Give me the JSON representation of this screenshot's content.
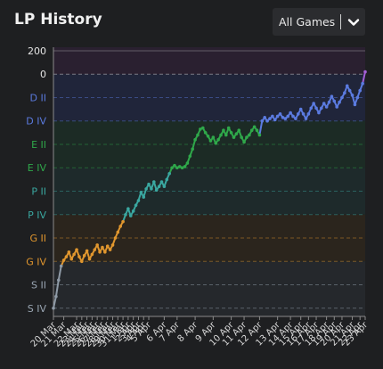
{
  "header": {
    "title": "LP History",
    "filter_label": "All Games"
  },
  "chart_data": {
    "type": "line",
    "title": "LP History",
    "y_ticks": [
      {
        "label": "200",
        "value": 200,
        "color": "#e6e6e6"
      },
      {
        "label": "0",
        "value": 0,
        "color": "#e6e6e6"
      },
      {
        "label": "D II",
        "value": -200,
        "color": "#5b7be0"
      },
      {
        "label": "D IV",
        "value": -400,
        "color": "#5b7be0"
      },
      {
        "label": "E II",
        "value": -600,
        "color": "#2fa84a"
      },
      {
        "label": "E IV",
        "value": -800,
        "color": "#2fa84a"
      },
      {
        "label": "P II",
        "value": -1000,
        "color": "#3aa7a0"
      },
      {
        "label": "P IV",
        "value": -1200,
        "color": "#3aa7a0"
      },
      {
        "label": "G II",
        "value": -1400,
        "color": "#e0962e"
      },
      {
        "label": "G IV",
        "value": -1600,
        "color": "#e0962e"
      },
      {
        "label": "S II",
        "value": -1800,
        "color": "#9aa6b3"
      },
      {
        "label": "S IV",
        "value": -2000,
        "color": "#9aa6b3"
      }
    ],
    "ylim": [
      -2070,
      230
    ],
    "x_ticks": [
      "20 Mar",
      "21 Mar",
      "22 Mar",
      "23 Mar",
      "24 Mar",
      "25 Mar",
      "26 Mar",
      "27 Mar",
      "28 Mar",
      "29 Mar",
      "30 Mar",
      "31 Mar",
      "1 Apr",
      "2 Apr",
      "3 Apr",
      "4 Apr",
      "5 Apr",
      "6 Apr",
      "7 Apr",
      "8 Apr",
      "9 Apr",
      "10 Apr",
      "11 Apr",
      "12 Apr",
      "13 Apr",
      "14 Apr",
      "15 Apr",
      "16 Apr",
      "17 Apr",
      "18 Apr",
      "19 Apr",
      "20 Apr",
      "21 Apr",
      "22 Apr",
      "23 Apr"
    ],
    "tier_colors": {
      "silver": "#8f9aa6",
      "gold": "#e0962e",
      "platinum": "#3aa7a0",
      "emerald": "#2fa84a",
      "diamond": "#5b7be0",
      "master": "#a45fd6"
    },
    "series": [
      {
        "points": [
          [
            0,
            -2000,
            "silver"
          ],
          [
            2,
            -1900,
            "silver"
          ],
          [
            4,
            -1760,
            "silver"
          ],
          [
            6,
            -1640,
            "silver"
          ],
          [
            8,
            -1590,
            "gold"
          ],
          [
            10,
            -1560,
            "gold"
          ],
          [
            12,
            -1520,
            "gold"
          ],
          [
            14,
            -1580,
            "gold"
          ],
          [
            16,
            -1540,
            "gold"
          ],
          [
            18,
            -1500,
            "gold"
          ],
          [
            20,
            -1560,
            "gold"
          ],
          [
            22,
            -1600,
            "gold"
          ],
          [
            24,
            -1550,
            "gold"
          ],
          [
            26,
            -1510,
            "gold"
          ],
          [
            28,
            -1580,
            "gold"
          ],
          [
            30,
            -1540,
            "gold"
          ],
          [
            32,
            -1500,
            "gold"
          ],
          [
            34,
            -1460,
            "gold"
          ],
          [
            36,
            -1520,
            "gold"
          ],
          [
            38,
            -1480,
            "gold"
          ],
          [
            40,
            -1520,
            "gold"
          ],
          [
            42,
            -1470,
            "gold"
          ],
          [
            44,
            -1500,
            "gold"
          ],
          [
            46,
            -1460,
            "gold"
          ],
          [
            48,
            -1400,
            "gold"
          ],
          [
            50,
            -1350,
            "gold"
          ],
          [
            52,
            -1300,
            "gold"
          ],
          [
            54,
            -1260,
            "gold"
          ],
          [
            56,
            -1200,
            "platinum"
          ],
          [
            58,
            -1150,
            "platinum"
          ],
          [
            60,
            -1210,
            "platinum"
          ],
          [
            62,
            -1170,
            "platinum"
          ],
          [
            64,
            -1120,
            "platinum"
          ],
          [
            66,
            -1080,
            "platinum"
          ],
          [
            68,
            -1010,
            "platinum"
          ],
          [
            70,
            -1050,
            "platinum"
          ],
          [
            72,
            -980,
            "platinum"
          ],
          [
            74,
            -940,
            "platinum"
          ],
          [
            76,
            -980,
            "platinum"
          ],
          [
            78,
            -920,
            "platinum"
          ],
          [
            80,
            -990,
            "platinum"
          ],
          [
            82,
            -960,
            "platinum"
          ],
          [
            84,
            -920,
            "platinum"
          ],
          [
            86,
            -960,
            "platinum"
          ],
          [
            88,
            -900,
            "platinum"
          ],
          [
            90,
            -850,
            "platinum"
          ],
          [
            92,
            -800,
            "emerald"
          ],
          [
            94,
            -780,
            "emerald"
          ],
          [
            96,
            -800,
            "emerald"
          ],
          [
            98,
            -790,
            "emerald"
          ],
          [
            100,
            -800,
            "emerald"
          ],
          [
            102,
            -790,
            "emerald"
          ],
          [
            104,
            -760,
            "emerald"
          ],
          [
            106,
            -700,
            "emerald"
          ],
          [
            108,
            -640,
            "emerald"
          ],
          [
            110,
            -560,
            "emerald"
          ],
          [
            112,
            -520,
            "emerald"
          ],
          [
            114,
            -470,
            "emerald"
          ],
          [
            116,
            -460,
            "emerald"
          ],
          [
            118,
            -500,
            "emerald"
          ],
          [
            120,
            -530,
            "emerald"
          ],
          [
            122,
            -570,
            "emerald"
          ],
          [
            124,
            -540,
            "emerald"
          ],
          [
            126,
            -590,
            "emerald"
          ],
          [
            128,
            -560,
            "emerald"
          ],
          [
            130,
            -520,
            "emerald"
          ],
          [
            132,
            -480,
            "emerald"
          ],
          [
            134,
            -520,
            "emerald"
          ],
          [
            136,
            -460,
            "emerald"
          ],
          [
            138,
            -500,
            "emerald"
          ],
          [
            140,
            -540,
            "emerald"
          ],
          [
            142,
            -510,
            "emerald"
          ],
          [
            144,
            -480,
            "emerald"
          ],
          [
            146,
            -540,
            "emerald"
          ],
          [
            148,
            -580,
            "emerald"
          ],
          [
            150,
            -540,
            "emerald"
          ],
          [
            152,
            -520,
            "emerald"
          ],
          [
            154,
            -480,
            "emerald"
          ],
          [
            156,
            -450,
            "emerald"
          ],
          [
            158,
            -480,
            "emerald"
          ],
          [
            160,
            -520,
            "emerald"
          ],
          [
            162,
            -400,
            "diamond"
          ],
          [
            164,
            -370,
            "diamond"
          ],
          [
            166,
            -400,
            "diamond"
          ],
          [
            168,
            -380,
            "diamond"
          ],
          [
            170,
            -360,
            "diamond"
          ],
          [
            172,
            -390,
            "diamond"
          ],
          [
            174,
            -360,
            "diamond"
          ],
          [
            176,
            -340,
            "diamond"
          ],
          [
            178,
            -370,
            "diamond"
          ],
          [
            180,
            -380,
            "diamond"
          ],
          [
            182,
            -360,
            "diamond"
          ],
          [
            184,
            -330,
            "diamond"
          ],
          [
            186,
            -360,
            "diamond"
          ],
          [
            188,
            -380,
            "diamond"
          ],
          [
            190,
            -340,
            "diamond"
          ],
          [
            192,
            -300,
            "diamond"
          ],
          [
            194,
            -340,
            "diamond"
          ],
          [
            196,
            -380,
            "diamond"
          ],
          [
            198,
            -340,
            "diamond"
          ],
          [
            200,
            -290,
            "diamond"
          ],
          [
            202,
            -250,
            "diamond"
          ],
          [
            204,
            -290,
            "diamond"
          ],
          [
            206,
            -330,
            "diamond"
          ],
          [
            208,
            -290,
            "diamond"
          ],
          [
            210,
            -250,
            "diamond"
          ],
          [
            212,
            -280,
            "diamond"
          ],
          [
            214,
            -240,
            "diamond"
          ],
          [
            216,
            -190,
            "diamond"
          ],
          [
            218,
            -230,
            "diamond"
          ],
          [
            220,
            -280,
            "diamond"
          ],
          [
            222,
            -240,
            "diamond"
          ],
          [
            224,
            -200,
            "diamond"
          ],
          [
            226,
            -160,
            "diamond"
          ],
          [
            228,
            -100,
            "diamond"
          ],
          [
            230,
            -140,
            "diamond"
          ],
          [
            232,
            -180,
            "diamond"
          ],
          [
            234,
            -260,
            "diamond"
          ],
          [
            236,
            -200,
            "diamond"
          ],
          [
            238,
            -140,
            "diamond"
          ],
          [
            240,
            -80,
            "diamond"
          ],
          [
            242,
            20,
            "master"
          ]
        ]
      }
    ],
    "grid": true
  }
}
